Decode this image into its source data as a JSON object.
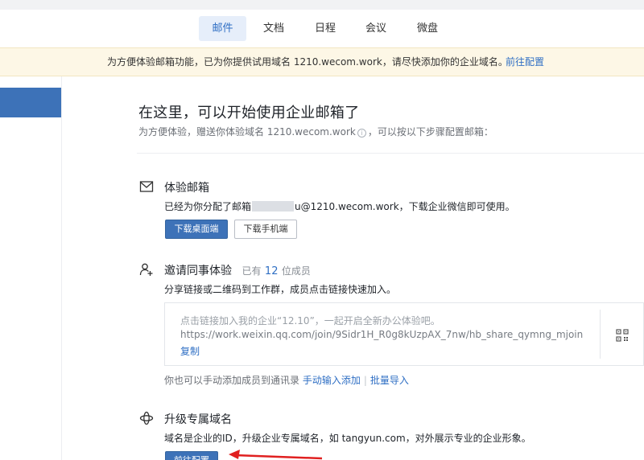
{
  "nav": {
    "tabs": [
      {
        "label": "邮件",
        "active": true
      },
      {
        "label": "文档",
        "active": false
      },
      {
        "label": "日程",
        "active": false
      },
      {
        "label": "会议",
        "active": false
      },
      {
        "label": "微盘",
        "active": false
      }
    ]
  },
  "notice": {
    "text": "为方便体验邮箱功能，已为你提供试用域名 1210.wecom.work，请尽快添加你的企业域名。",
    "link": "前往配置"
  },
  "main": {
    "headline": "在这里，可以开始使用企业邮箱了",
    "sub_before": "为方便体验，赠送你体验域名 1210.wecom.work",
    "sub_after": "，可以按以下步骤配置邮箱："
  },
  "mailbox": {
    "icon": "envelope-icon",
    "title": "体验邮箱",
    "desc_before": "已经为你分配了邮箱",
    "desc_after": "u@1210.wecom.work，下载企业微信即可使用。",
    "btn_desktop": "下载桌面端",
    "btn_mobile": "下载手机端"
  },
  "invite": {
    "icon": "add-user-icon",
    "title": "邀请同事体验",
    "count_prefix": "已有",
    "count": "12",
    "count_suffix": "位成员",
    "desc": "分享链接或二维码到工作群，成员点击链接快速加入。",
    "share_text": "点击链接加入我的企业“12.10”，一起开启全新办公体验吧。",
    "share_url": "https://work.weixin.qq.com/join/9Sidr1H_R0g8kUzpAX_7nw/hb_share_qymng_mjoin",
    "copy_label": "复制",
    "manual_text": "你也可以手动添加成员到通讯录",
    "manual_link": "手动输入添加",
    "import_link": "批量导入"
  },
  "domain": {
    "icon": "globe-icon",
    "title": "升级专属域名",
    "desc": "域名是企业的ID，升级企业专属域名，如 tangyun.com，对外展示专业的企业形象。",
    "btn": "前往配置"
  },
  "colors": {
    "accent": "#3d72b8",
    "link": "#2f6fc4",
    "notice_bg": "#fdf7e6",
    "arrow": "#e02020"
  }
}
